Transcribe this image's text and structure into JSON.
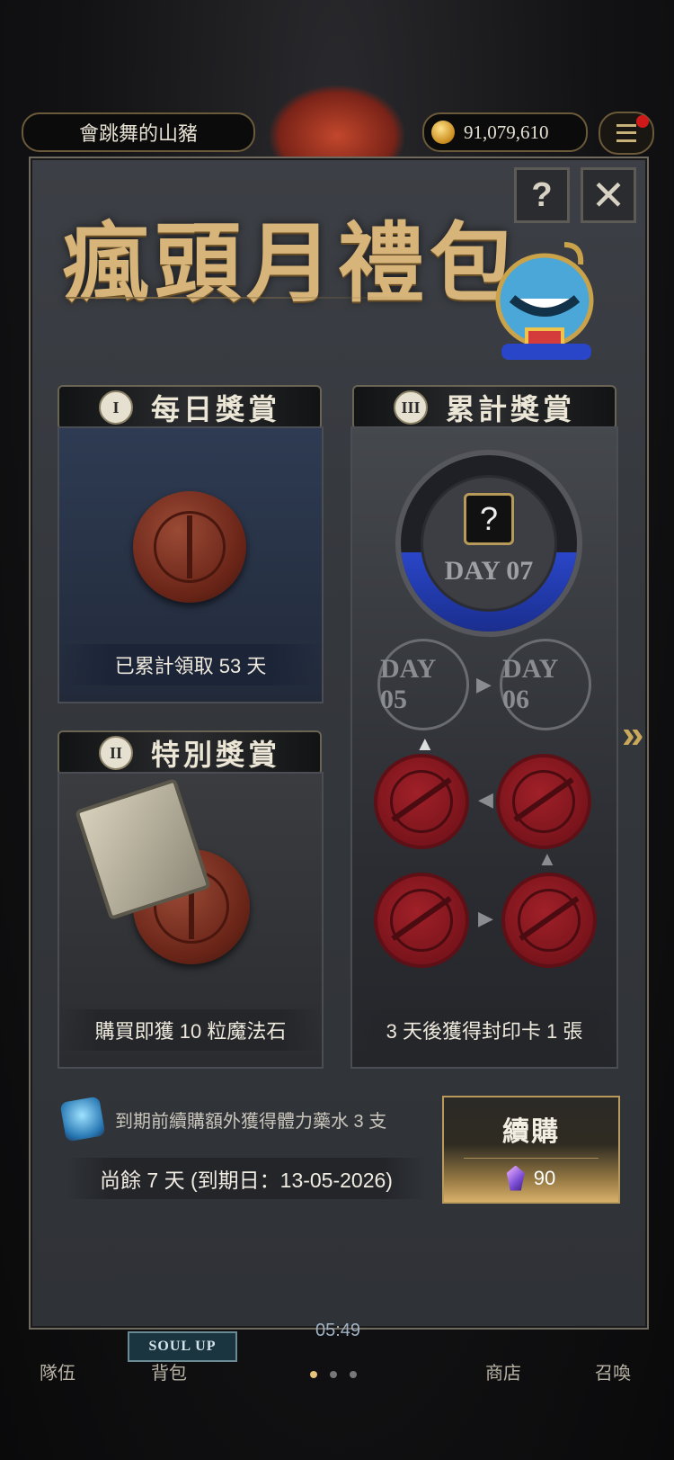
{
  "topbar": {
    "player_name": "會跳舞的山豬",
    "coins": "91,079,610"
  },
  "panel": {
    "title": "瘋頭月禮包",
    "help_label": "?",
    "close_label": "✕"
  },
  "daily": {
    "numeral": "I",
    "header": "每日獎賞",
    "caption": "已累計領取 53 天"
  },
  "special": {
    "numeral": "II",
    "header": "特別獎賞",
    "caption": "購買即獲 10 粒魔法石"
  },
  "cumulative": {
    "numeral": "III",
    "header": "累計獎賞",
    "current_day": "DAY 07",
    "day_a": "DAY 05",
    "day_b": "DAY 06",
    "caption": "3 天後獲得封印卡 1 張",
    "progress_fraction": 0.45
  },
  "footer": {
    "potion_text": "到期前續購額外獲得體力藥水 3 支",
    "remaining": "尚餘 7 天 (到期日：13-05-2026)",
    "renew_label": "續購",
    "renew_price": "90"
  },
  "bottom_nav": {
    "soul_up": "SOUL UP",
    "time": "05:49",
    "team": "隊伍",
    "bag": "背包",
    "shop": "商店",
    "summon": "召喚"
  },
  "colors": {
    "gold": "#d7b57a",
    "progress_blue": "#2a46c8",
    "seal_red": "#a02028"
  }
}
